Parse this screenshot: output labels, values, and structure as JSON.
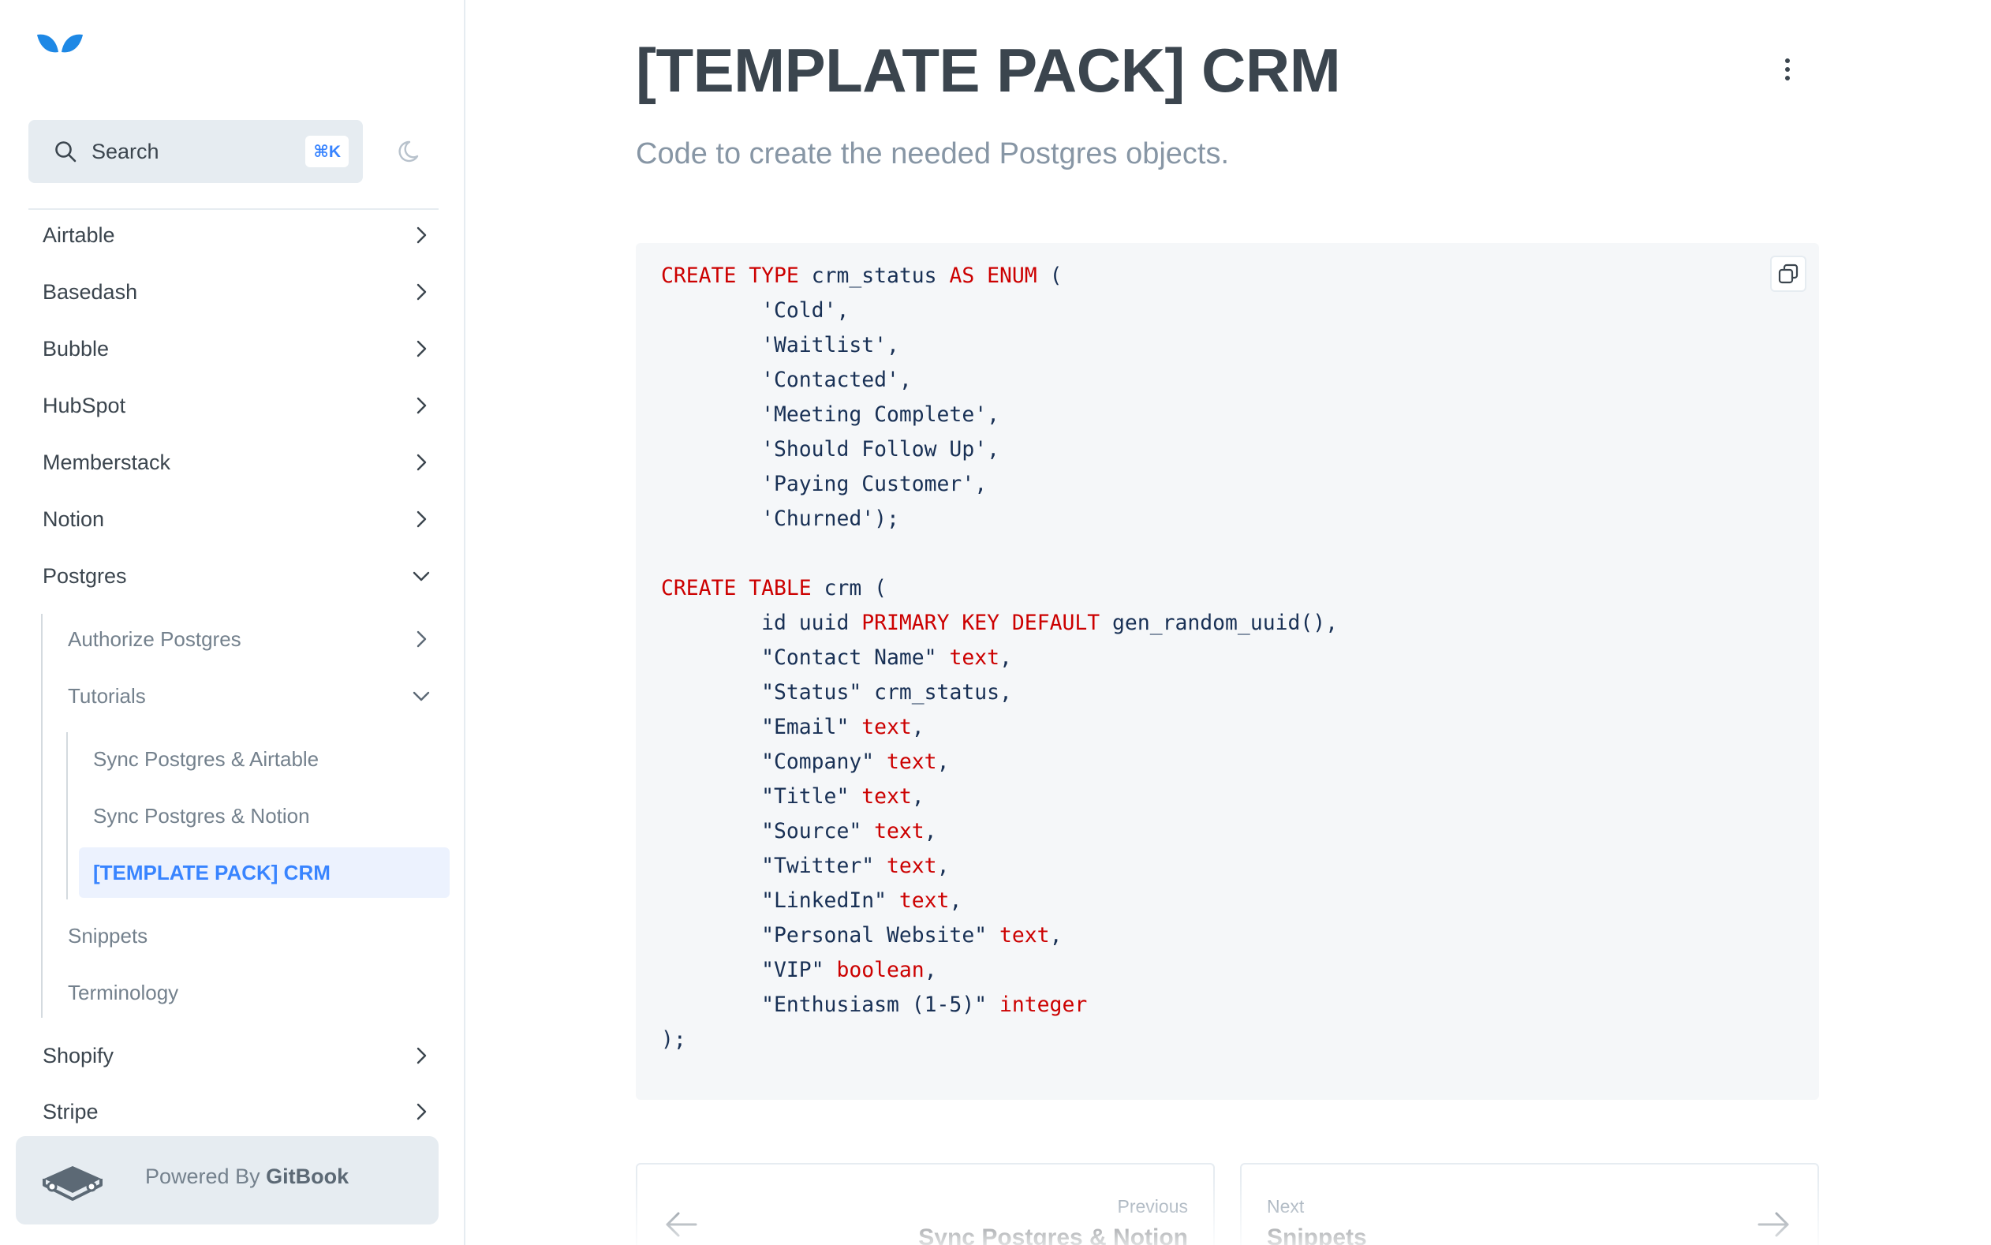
{
  "sidebar": {
    "search": {
      "label": "Search",
      "shortcut": "⌘K"
    },
    "items": [
      {
        "label": "Airtable"
      },
      {
        "label": "Basedash"
      },
      {
        "label": "Bubble"
      },
      {
        "label": "HubSpot"
      },
      {
        "label": "Memberstack"
      },
      {
        "label": "Notion"
      },
      {
        "label": "Postgres"
      },
      {
        "label": "Shopify"
      },
      {
        "label": "Stripe"
      }
    ],
    "postgres_children": [
      {
        "label": "Authorize Postgres"
      },
      {
        "label": "Tutorials"
      },
      {
        "label": "Snippets"
      },
      {
        "label": "Terminology"
      }
    ],
    "tutorials_children": [
      {
        "label": "Sync Postgres & Airtable"
      },
      {
        "label": "Sync Postgres & Notion"
      },
      {
        "label": "[TEMPLATE PACK] CRM",
        "active": true
      }
    ],
    "powered_by": {
      "prefix": "Powered By",
      "brand": "GitBook"
    }
  },
  "page": {
    "title": "[TEMPLATE PACK] CRM",
    "description": "Code to create the needed Postgres objects."
  },
  "code": {
    "language": "sql",
    "lines": [
      "CREATE TYPE crm_status AS ENUM (",
      "        'Cold',",
      "        'Waitlist',",
      "        'Contacted',",
      "        'Meeting Complete',",
      "        'Should Follow Up',",
      "        'Paying Customer',",
      "        'Churned');",
      "",
      "CREATE TABLE crm (",
      "        id uuid PRIMARY KEY DEFAULT gen_random_uuid(),",
      "        \"Contact Name\" text,",
      "        \"Status\" crm_status,",
      "        \"Email\" text,",
      "        \"Company\" text,",
      "        \"Title\" text,",
      "        \"Source\" text,",
      "        \"Twitter\" text,",
      "        \"LinkedIn\" text,",
      "        \"Personal Website\" text,",
      "        \"VIP\" boolean,",
      "        \"Enthusiasm (1-5)\" integer",
      ");"
    ],
    "keywords": [
      "CREATE",
      "TYPE",
      "AS",
      "ENUM",
      "TABLE",
      "PRIMARY",
      "KEY",
      "DEFAULT",
      "text",
      "boolean",
      "integer"
    ]
  },
  "pager": {
    "previous": {
      "caption": "Previous",
      "title": "Sync Postgres & Notion"
    },
    "next": {
      "caption": "Next",
      "title": "Snippets"
    }
  },
  "colors": {
    "accent": "#3884ff",
    "keyword": "#cc0000",
    "code_bg": "#f5f7f9",
    "brand_logo": "#1e88e5"
  }
}
